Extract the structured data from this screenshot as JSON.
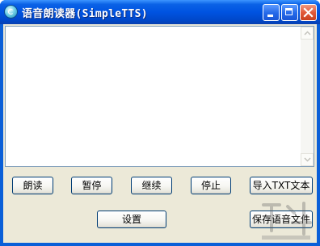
{
  "window": {
    "title": "语音朗读器(SimpleTTS)"
  },
  "icons": {
    "app": "app-icon",
    "minimize": "minimize-icon",
    "maximize": "maximize-icon",
    "close": "close-icon",
    "scroll_up": "chevron-up-icon",
    "scroll_down": "chevron-down-icon"
  },
  "text_area": {
    "value": ""
  },
  "buttons": {
    "read": "朗读",
    "pause": "暂停",
    "resume": "继续",
    "stop": "停止",
    "import_txt": "导入TXT文本",
    "settings": "设置",
    "save_audio": "保存语音文件"
  },
  "colors": {
    "titlebar": "#0053e1",
    "client_bg": "#ece9d8",
    "close_button": "#e2593a"
  }
}
